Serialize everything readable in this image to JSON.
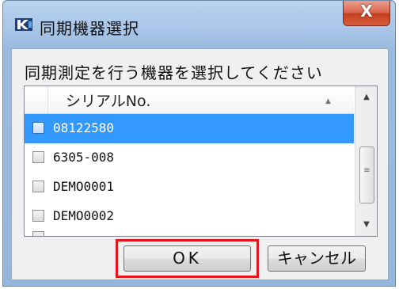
{
  "window": {
    "title": "同期機器選択",
    "close_label": "X",
    "icon": "app-k-icon",
    "highlight_color": "#e8141b",
    "selection_color": "#3399ff"
  },
  "dialog": {
    "prompt": "同期測定を行う機器を選択してください",
    "list": {
      "column_header": "シリアルNo.",
      "sort_indicator": "▲",
      "rows": [
        {
          "serial": "08122580",
          "checked": false,
          "selected": true
        },
        {
          "serial": "6305-008",
          "checked": false,
          "selected": false
        },
        {
          "serial": "DEMO0001",
          "checked": false,
          "selected": false
        },
        {
          "serial": "DEMO0002",
          "checked": false,
          "selected": false
        }
      ],
      "scroll_up_icon": "▲",
      "scroll_down_icon": "▼",
      "scroll_grip": "≡"
    },
    "ok_label": "OK",
    "cancel_label": "キャンセル"
  }
}
